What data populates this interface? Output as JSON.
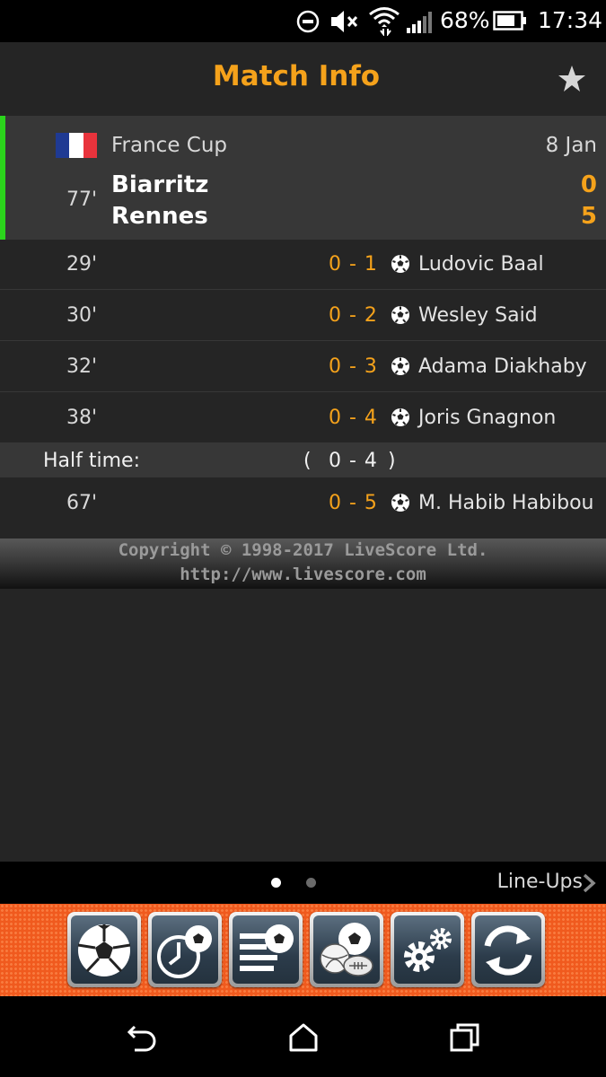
{
  "status_bar": {
    "battery_percent": "68%",
    "time": "17:34"
  },
  "header": {
    "title": "Match Info"
  },
  "match": {
    "competition": "France Cup",
    "date": "8 Jan",
    "minute": "77'",
    "home_team": "Biarritz",
    "away_team": "Rennes",
    "home_score": "0",
    "away_score": "5",
    "flag_colors": [
      "#1f3a93",
      "#ffffff",
      "#e8333c"
    ],
    "status_color": "#2bd41c"
  },
  "events": [
    {
      "minute": "29'",
      "score": "0 - 1",
      "player": "Ludovic Baal"
    },
    {
      "minute": "30'",
      "score": "0 - 2",
      "player": "Wesley Said"
    },
    {
      "minute": "32'",
      "score": "0 - 3",
      "player": "Adama Diakhaby"
    },
    {
      "minute": "38'",
      "score": "0 - 4",
      "player": "Joris Gnagnon"
    },
    {
      "minute": "67'",
      "score": "0 - 5",
      "player": "M. Habib Habibou"
    }
  ],
  "half_time": {
    "label": "Half time:",
    "open": "(",
    "score": "0 - 4",
    "close": ")"
  },
  "copyright": {
    "line1": "Copyright © 1998-2017 LiveScore Ltd.",
    "line2": "http://www.livescore.com"
  },
  "pager": {
    "next_label": "Line-Ups",
    "active_page": 1,
    "page_count": 2
  },
  "toolbar": {
    "buttons": [
      "soccer-ball-icon",
      "live-clock-icon",
      "fixtures-list-icon",
      "multi-sports-icon",
      "settings-gears-icon",
      "refresh-icon"
    ]
  },
  "colors": {
    "accent": "#f5a21b",
    "toolbar": "#f05a1e",
    "background": "#252525",
    "row_highlight": "#373737"
  }
}
